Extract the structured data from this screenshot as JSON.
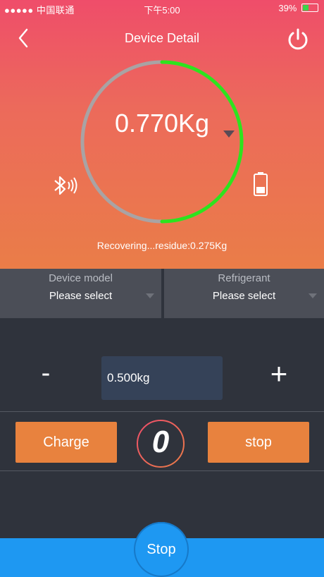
{
  "status_bar": {
    "carrier": "●●●●● 中国联通",
    "time": "下午5:00",
    "battery_percent": "39%"
  },
  "header": {
    "title": "Device Detail"
  },
  "gauge": {
    "weight": "0.770Kg",
    "progress_fraction": 0.5,
    "progress_color": "#2ee31d",
    "track_color": "#a9a3a4"
  },
  "status_message": "Recovering...residue:0.275Kg",
  "selects": {
    "device_model": {
      "label": "Device model",
      "value": "Please select"
    },
    "refrigerant": {
      "label": "Refrigerant",
      "value": "Please select"
    }
  },
  "quantity": {
    "minus_label": "-",
    "value": "0.500kg",
    "plus_label": "+"
  },
  "actions": {
    "charge_label": "Charge",
    "counter": "0",
    "stop_label": "stop"
  },
  "bottom": {
    "stop_label": "Stop"
  },
  "icons": {
    "back": "chevron-left-icon",
    "power": "power-icon",
    "bluetooth": "bluetooth-icon",
    "battery": "battery-icon"
  },
  "colors": {
    "hero_top": "#ef4d6a",
    "hero_bottom": "#ea7d48",
    "action_orange": "#e8823e",
    "bottom_blue": "#1e98f2"
  }
}
